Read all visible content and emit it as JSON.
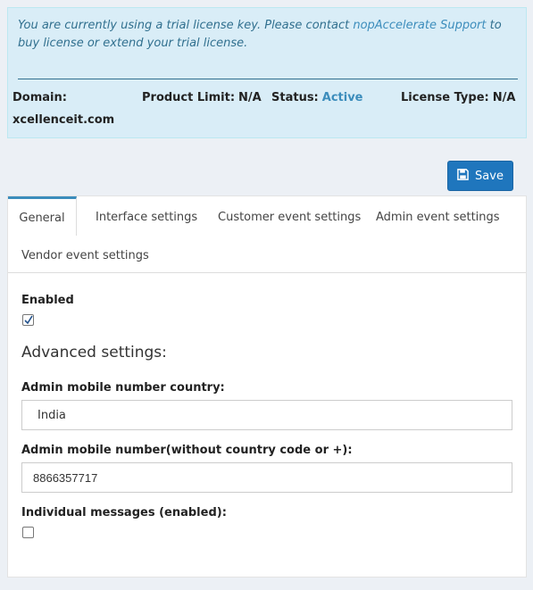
{
  "license": {
    "message_prefix": "You are currently using a trial license key. Please contact ",
    "support_link": "nopAccelerate Support",
    "message_suffix": " to buy license or extend your trial license.",
    "domain_label": "Domain:",
    "domain_value": "xcellenceit.com",
    "product_limit_label": "Product Limit:",
    "product_limit_value": "N/A",
    "status_label": "Status:",
    "status_value": "Active",
    "license_type_label": "License Type:",
    "license_type_value": "N/A"
  },
  "toolbar": {
    "save_label": "Save",
    "save_icon": "floppy-disk-icon"
  },
  "tabs": [
    {
      "label": "General",
      "active": true
    },
    {
      "label": "Interface settings"
    },
    {
      "label": "Customer event settings"
    },
    {
      "label": "Admin event settings"
    },
    {
      "label": "Vendor event settings"
    }
  ],
  "form": {
    "enabled_label": "Enabled",
    "enabled_checked": true,
    "advanced_heading": "Advanced settings:",
    "country_label": "Admin mobile number country:",
    "country_value": "India",
    "number_label": "Admin mobile number(without country code or +):",
    "number_value": "8866357717",
    "individual_label": "Individual messages (enabled):",
    "individual_checked": false
  }
}
